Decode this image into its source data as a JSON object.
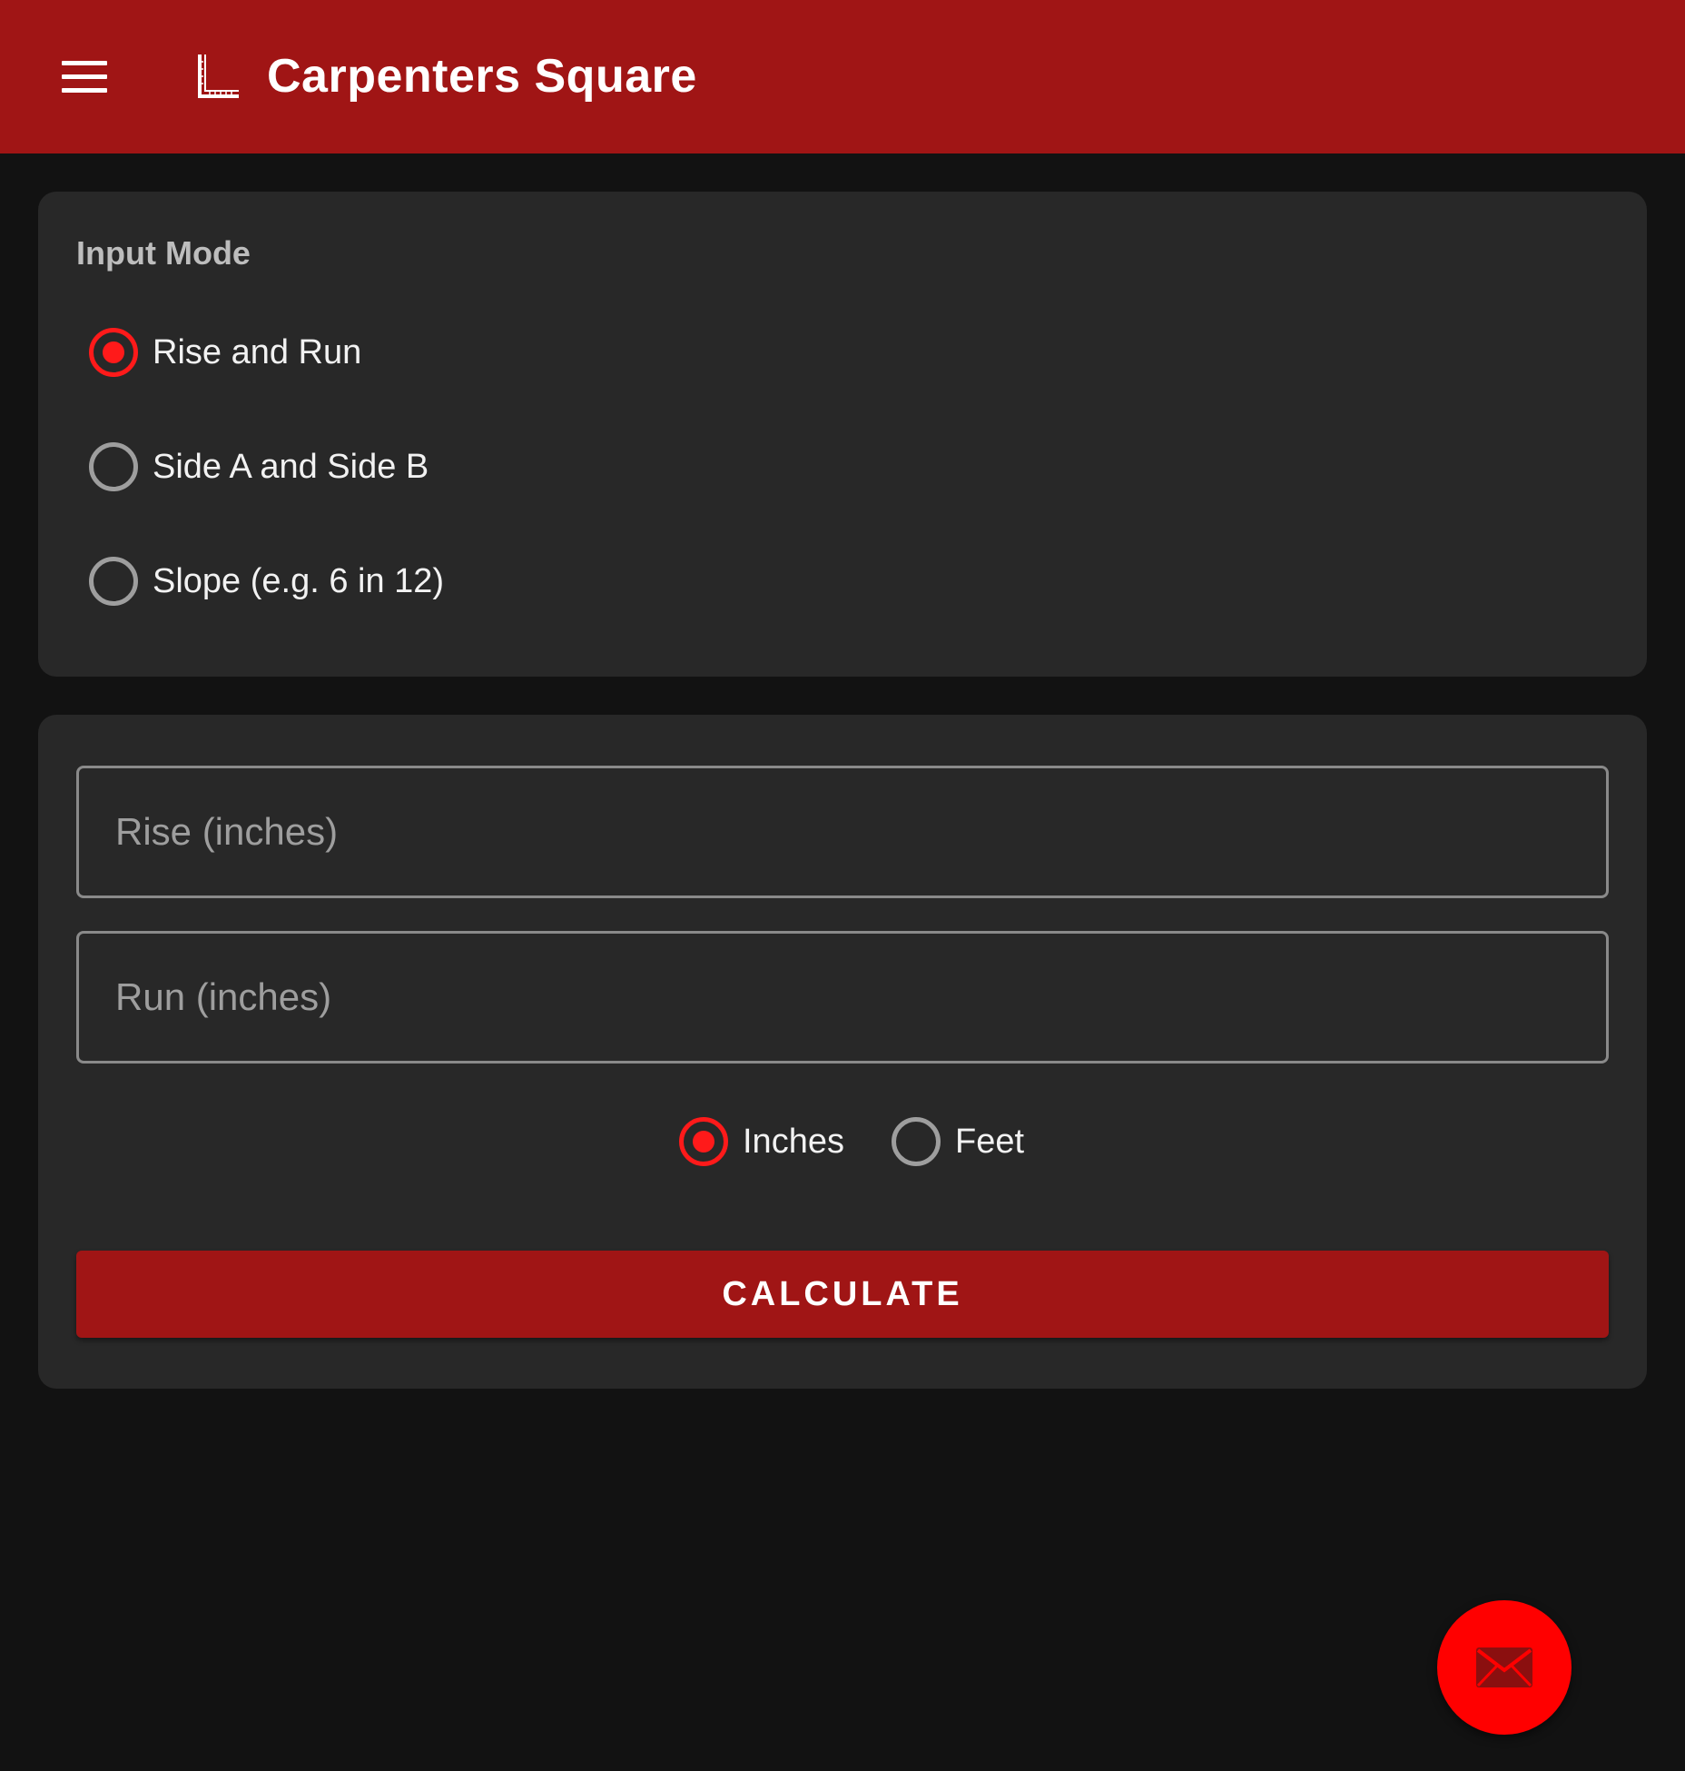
{
  "appbar": {
    "title": "Carpenters Square",
    "brand_color": "#a01515"
  },
  "mode_card": {
    "label": "Input Mode",
    "options": [
      {
        "label": "Rise and Run",
        "selected": true
      },
      {
        "label": "Side A and Side B",
        "selected": false
      },
      {
        "label": "Slope (e.g. 6 in 12)",
        "selected": false
      }
    ]
  },
  "inputs": {
    "rise": {
      "placeholder": "Rise (inches)",
      "value": ""
    },
    "run": {
      "placeholder": "Run (inches)",
      "value": ""
    }
  },
  "units": {
    "options": [
      {
        "label": "Inches",
        "selected": true
      },
      {
        "label": "Feet",
        "selected": false
      }
    ]
  },
  "actions": {
    "calculate_label": "CALCULATE"
  },
  "icons": {
    "menu": "menu-icon",
    "app": "carpenters-square-icon",
    "fab": "mail-icon"
  },
  "colors": {
    "accent": "#ff1a1a",
    "background": "#121212",
    "card": "#282828"
  }
}
